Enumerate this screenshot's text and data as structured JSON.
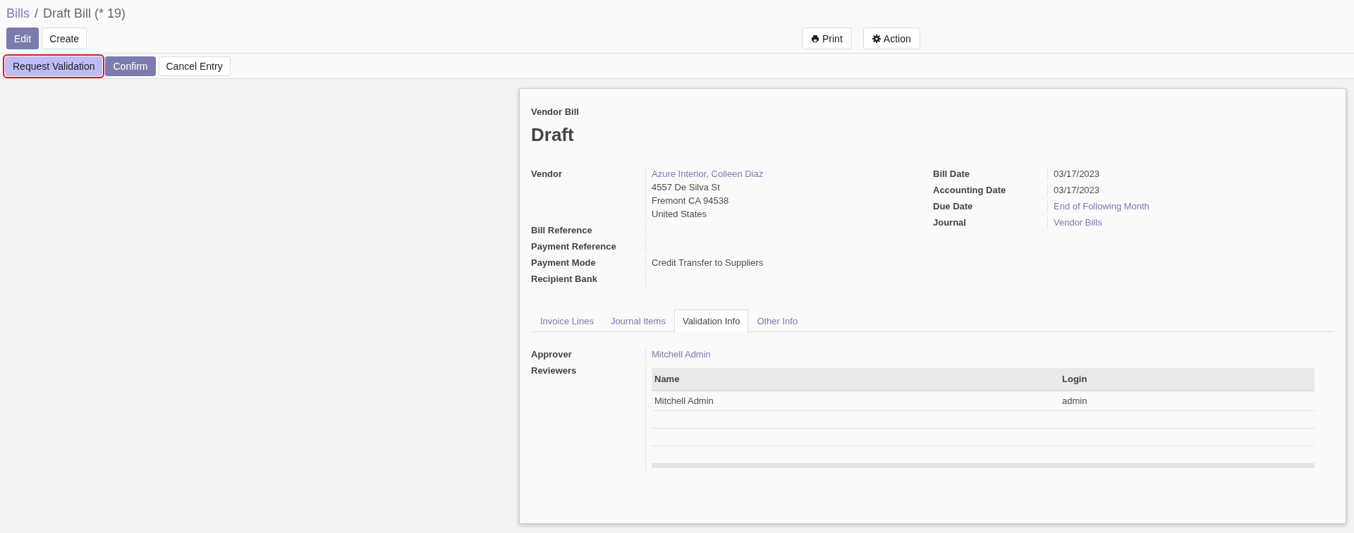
{
  "breadcrumb": [
    {
      "label": "Bills",
      "kind": "link"
    },
    {
      "label": "/",
      "kind": "separator"
    },
    {
      "label": "Draft Bill (* 19)",
      "kind": "current"
    }
  ],
  "control_buttons": [
    {
      "label": "Edit",
      "kind": "primary"
    },
    {
      "label": "Create",
      "kind": "secondary"
    }
  ],
  "action_buttons": [
    {
      "label": "Print",
      "kind": "print"
    },
    {
      "label": "Action",
      "kind": "gear"
    }
  ],
  "status_buttons": [
    {
      "label": "Request Validation",
      "kind": "highlight",
      "highlighted": true
    },
    {
      "label": "Confirm",
      "kind": "primary",
      "highlighted": false
    },
    {
      "label": "Cancel Entry",
      "kind": "secondary",
      "highlighted": false
    }
  ],
  "sheet": {
    "subtitle": "Vendor Bill",
    "title": "Draft",
    "left_fields": [
      {
        "label": "Vendor",
        "lines": [
          {
            "text": "Azure Interior, Colleen Diaz",
            "kind": "link"
          },
          {
            "text": "4557 De Silva St",
            "kind": "text"
          },
          {
            "text": "Fremont CA 94538",
            "kind": "text"
          },
          {
            "text": "United States",
            "kind": "text"
          }
        ]
      },
      {
        "label": "Bill Reference"
      },
      {
        "label": "Payment Reference"
      },
      {
        "label": "Payment Mode",
        "lines": [
          {
            "text": "Credit Transfer to Suppliers",
            "kind": "text"
          }
        ]
      },
      {
        "label": "Recipient Bank"
      }
    ],
    "right_fields": [
      {
        "label": "Bill Date",
        "value": "03/17/2023",
        "kind": "text"
      },
      {
        "label": "Accounting Date",
        "value": "03/17/2023",
        "kind": "text"
      },
      {
        "label": "Due Date",
        "value": "End of Following Month",
        "kind": "link"
      },
      {
        "label": "Journal",
        "value": "Vendor Bills",
        "kind": "link"
      }
    ],
    "tabs": [
      {
        "label": "Invoice Lines",
        "selected": false
      },
      {
        "label": "Journal Items",
        "selected": false
      },
      {
        "label": "Validation Info",
        "selected": true
      },
      {
        "label": "Other Info",
        "selected": false
      }
    ],
    "approver": {
      "label": "Approver",
      "value": "Mitchell Admin"
    },
    "reviewers": {
      "label": "Reviewers",
      "columns": [
        "Name",
        "Login"
      ],
      "rows": [
        [
          "Mitchell Admin",
          "admin"
        ]
      ]
    }
  }
}
